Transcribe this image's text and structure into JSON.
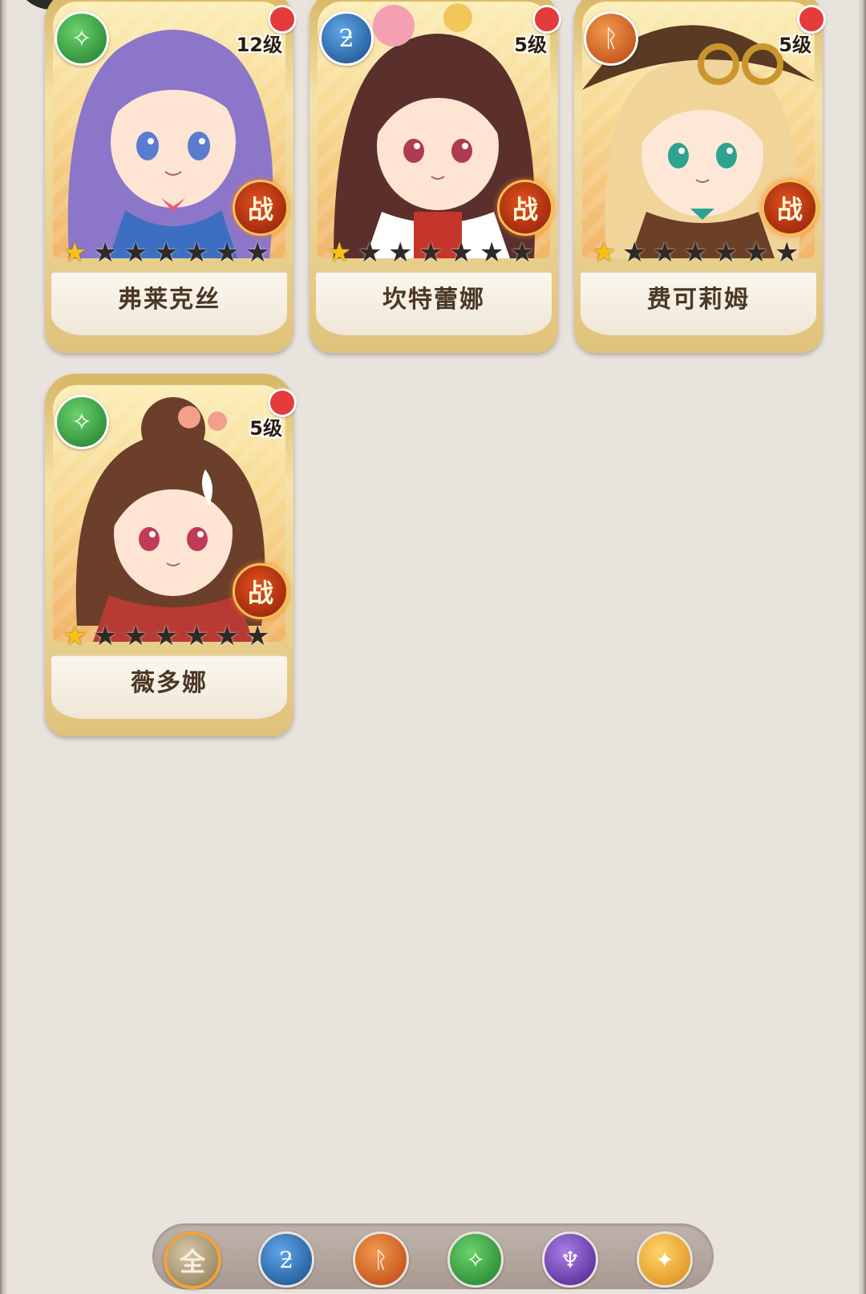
{
  "cards": [
    {
      "name": "弗莱克丝",
      "level": "12级",
      "element": "wind",
      "element_icon": "wind-element-icon",
      "badge": "战",
      "stars_filled": 1,
      "stars_total": 7,
      "hair": "#8c76c9",
      "skin": "#fde4d3",
      "eye": "#5a7cd0"
    },
    {
      "name": "坎特蕾娜",
      "level": "5级",
      "element": "water",
      "element_icon": "water-element-icon",
      "badge": "战",
      "stars_filled": 1,
      "stars_total": 7,
      "hair": "#5a2f2c",
      "skin": "#fde4d3",
      "eye": "#b03a4e"
    },
    {
      "name": "费可莉姆",
      "level": "5级",
      "element": "fire",
      "element_icon": "fire-element-icon",
      "badge": "战",
      "stars_filled": 1,
      "stars_total": 7,
      "hair": "#f0d49a",
      "skin": "#fde8d8",
      "eye": "#2ea38f"
    },
    {
      "name": "薇多娜",
      "level": "5级",
      "element": "wind",
      "element_icon": "wind-element-icon",
      "badge": "战",
      "stars_filled": 1,
      "stars_total": 7,
      "hair": "#6b3f2a",
      "skin": "#fde4d3",
      "eye": "#c03b55"
    }
  ],
  "filter": {
    "all_label": "全",
    "buttons": [
      "all",
      "water",
      "fire",
      "wind",
      "dark",
      "light"
    ],
    "selected": "all"
  },
  "colors": {
    "background": "#e9e3de",
    "red_dot": "#e43b3b",
    "star_on": "#f6c21a",
    "star_off": "#2f2a26"
  }
}
